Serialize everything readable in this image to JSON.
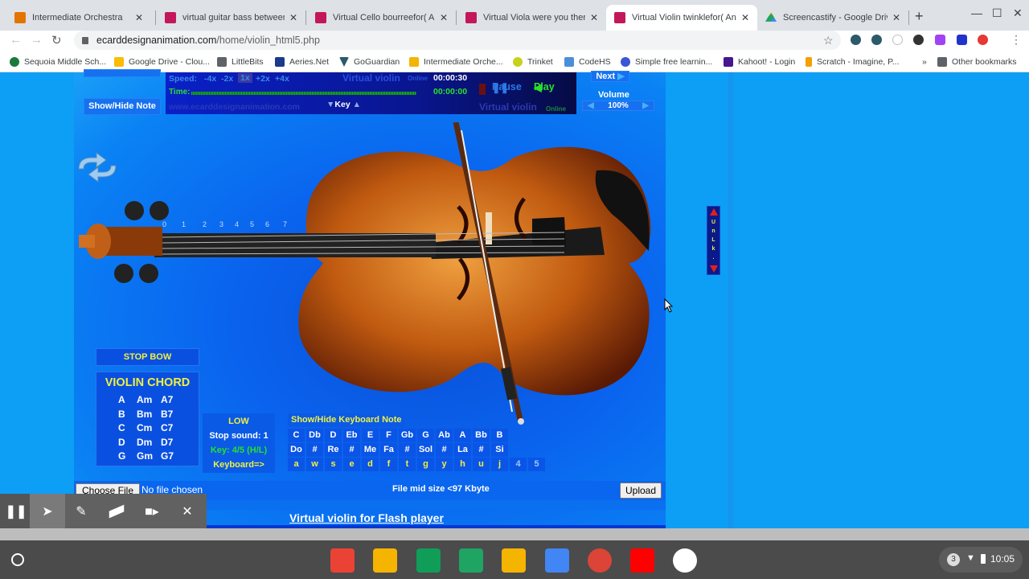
{
  "browser": {
    "tabs": [
      {
        "title": "Intermediate Orchestra",
        "icon": "classroom-icon",
        "color": "#e37400",
        "active": false
      },
      {
        "title": "virtual guitar bass between us",
        "icon": "ecard-icon",
        "color": "#c2185b",
        "active": false
      },
      {
        "title": "Virtual Cello bourreefor( Andr",
        "icon": "ecard-icon",
        "color": "#c2185b",
        "active": false
      },
      {
        "title": "Virtual Viola were you therefor",
        "icon": "ecard-icon",
        "color": "#c2185b",
        "active": false
      },
      {
        "title": "Virtual Violin twinklefor( Andr",
        "icon": "ecard-icon",
        "color": "#c2185b",
        "active": true
      },
      {
        "title": "Screencastify - Google Drive",
        "icon": "drive-icon",
        "color": "#1fa463",
        "active": false
      }
    ],
    "close_glyph": "✕",
    "new_tab_glyph": "+",
    "url_domain": "ecarddesignanimation.com",
    "url_path": "/home/violin_html5.php",
    "bookmarks": [
      {
        "label": "Sequoia Middle Sch...",
        "color": "#1b7a3a"
      },
      {
        "label": "Google Drive - Clou...",
        "color": "#fbbc04"
      },
      {
        "label": "LittleBits",
        "color": "#5f6368"
      },
      {
        "label": "Aeries.Net",
        "color": "#1a3a8a"
      },
      {
        "label": "GoGuardian",
        "color": "#2b5a6a"
      },
      {
        "label": "Intermediate Orche...",
        "color": "#f4b400"
      },
      {
        "label": "Trinket",
        "color": "#c8d020"
      },
      {
        "label": "CodeHS",
        "color": "#4a90d9"
      },
      {
        "label": "Simple free learnin...",
        "color": "#3a56d4"
      },
      {
        "label": "Kahoot! - Login",
        "color": "#46178f"
      },
      {
        "label": "Scratch - Imagine, P...",
        "color": "#f4a000"
      }
    ],
    "more_bookmarks": "»",
    "other_bookmarks": "Other bookmarks"
  },
  "player": {
    "speed_label": "Speed:",
    "speeds": [
      "-4x",
      "-2x",
      "1x",
      "+2x",
      "+4x"
    ],
    "selected_speed": "1x",
    "title_top": "Virtual violin",
    "online_top": "Online",
    "total_time": "00:00:30",
    "time_label": "Time:",
    "elapsed_time": "00:00:00",
    "progress": 0,
    "pause_label": "Pause",
    "play_label": "Play",
    "website": "www.ecarddesignanimation.com",
    "key_label": "Key",
    "title_bottom": "Virtual violin",
    "online_bottom": "Online",
    "show_hide_note": "Show/Hide Note",
    "next_label": "Next",
    "volume_label": "Volume",
    "volume_value": "100%"
  },
  "fingerboard_positions": [
    "0",
    "1",
    "2",
    "3",
    "4",
    "5",
    "6",
    "7"
  ],
  "stop_bow": "STOP BOW",
  "chord_panel": {
    "title": "VIOLIN CHORD",
    "rows": [
      [
        "A",
        "Am",
        "A7"
      ],
      [
        "B",
        "Bm",
        "B7"
      ],
      [
        "C",
        "Cm",
        "C7"
      ],
      [
        "D",
        "Dm",
        "D7"
      ],
      [
        "G",
        "Gm",
        "G7"
      ]
    ]
  },
  "settings_panel": {
    "range": "LOW",
    "stop_sound": "Stop sound: 1",
    "key": "Key: 4/5 (H/L)",
    "keyboard": "Keyboard=>"
  },
  "keyboard": {
    "toggle_label": "Show/Hide Keyboard Note",
    "notes": [
      "C",
      "Db",
      "D",
      "Eb",
      "E",
      "F",
      "Gb",
      "G",
      "Ab",
      "A",
      "Bb",
      "B"
    ],
    "solfege": [
      "Do",
      "#",
      "Re",
      "#",
      "Me",
      "Fa",
      "#",
      "Sol",
      "#",
      "La",
      "#",
      "Si"
    ],
    "keys": [
      "a",
      "w",
      "s",
      "e",
      "d",
      "f",
      "t",
      "g",
      "y",
      "h",
      "u",
      "j"
    ],
    "octave_keys": [
      "4",
      "5"
    ]
  },
  "file_bar": {
    "choose_file": "Choose File",
    "no_file": "No file chosen",
    "size_note": "File mid size <97 Kbyte",
    "upload": "Upload"
  },
  "flash_link": "Virtual violin for Flash player",
  "unlock_scroller": {
    "letters": [
      "U",
      "n",
      "L",
      "k",
      "."
    ]
  },
  "screencastify_tools": [
    "pause-icon",
    "cursor-icon",
    "pen-icon",
    "eraser-icon",
    "camera-icon",
    "close-icon"
  ],
  "shelf": {
    "apps": [
      {
        "name": "gmail",
        "color": "#ea4335"
      },
      {
        "name": "slides",
        "color": "#f4b400"
      },
      {
        "name": "sheets",
        "color": "#0f9d58"
      },
      {
        "name": "drive",
        "color": "#1fa463"
      },
      {
        "name": "classroom",
        "color": "#f4b400"
      },
      {
        "name": "docs",
        "color": "#4285f4"
      },
      {
        "name": "chrome",
        "color": "#db4437"
      },
      {
        "name": "youtube",
        "color": "#ff0000"
      },
      {
        "name": "play-store",
        "color": "#ffffff"
      }
    ],
    "notifications": "3",
    "time": "10:05"
  }
}
